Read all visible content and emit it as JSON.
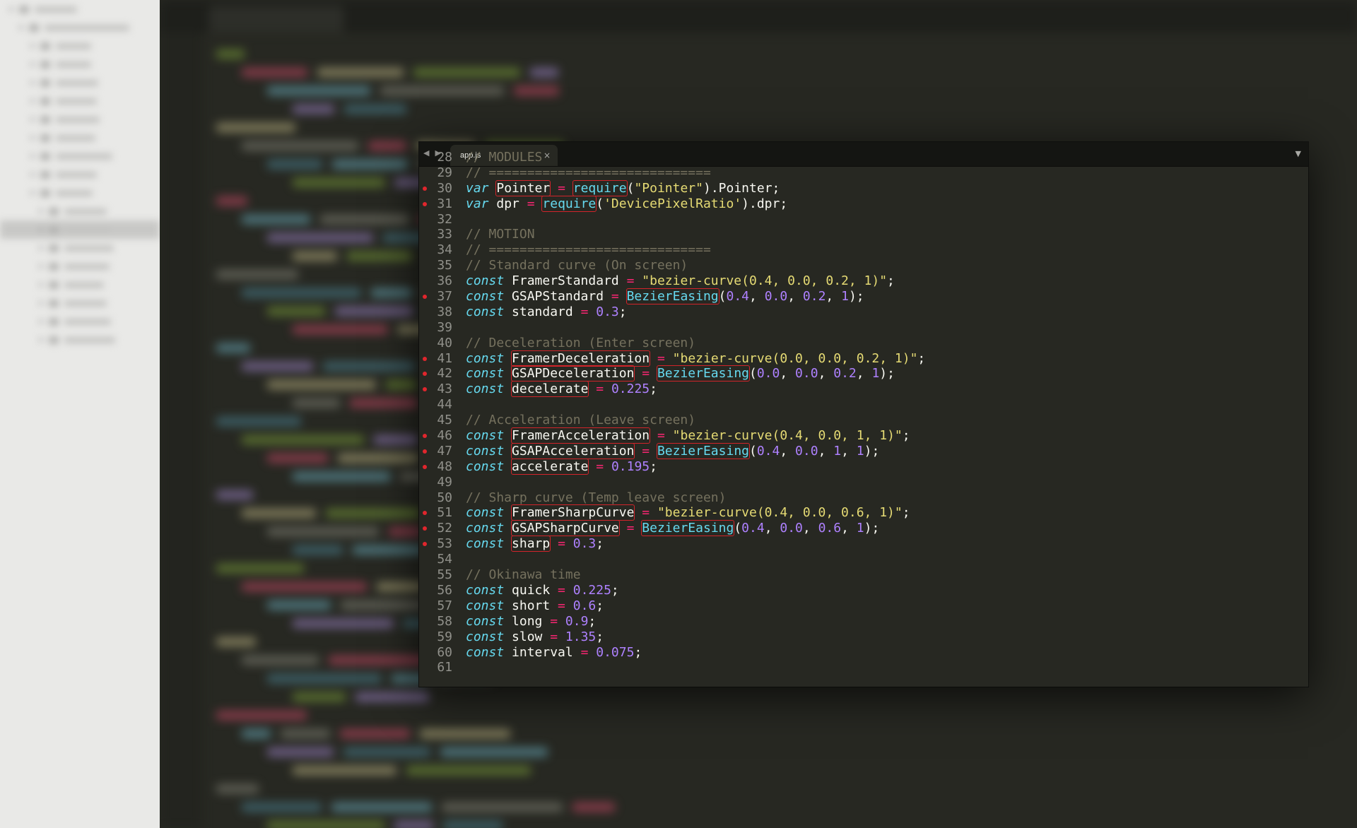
{
  "window": {
    "tab_title": "app.js",
    "nav_back": "◀",
    "nav_forward": "▶",
    "close_glyph": "×",
    "dropdown_glyph": "▼"
  },
  "colors": {
    "background": "#272822",
    "keyword": "#66d9ef",
    "operator": "#f92672",
    "string": "#e6db74",
    "number": "#ae81ff",
    "comment": "#75715e",
    "lint_marker": "#e0262d"
  },
  "code": {
    "lines": [
      {
        "n": "28",
        "marker": false,
        "tokens": [
          {
            "t": "// MODULES",
            "c": "cm"
          }
        ]
      },
      {
        "n": "29",
        "marker": false,
        "tokens": [
          {
            "t": "// =============================",
            "c": "cm"
          }
        ]
      },
      {
        "n": "30",
        "marker": true,
        "tokens": [
          {
            "t": "var",
            "c": "kw"
          },
          {
            "t": " "
          },
          {
            "t": "Pointer",
            "l": true
          },
          {
            "t": " "
          },
          {
            "t": "=",
            "c": "op"
          },
          {
            "t": " "
          },
          {
            "t": "require",
            "c": "fn",
            "l": true
          },
          {
            "t": "("
          },
          {
            "t": "\"Pointer\"",
            "c": "str"
          },
          {
            "t": ").Pointer;"
          }
        ]
      },
      {
        "n": "31",
        "marker": true,
        "tokens": [
          {
            "t": "var",
            "c": "kw"
          },
          {
            "t": " dpr "
          },
          {
            "t": "=",
            "c": "op"
          },
          {
            "t": " "
          },
          {
            "t": "require",
            "c": "fn",
            "l": true
          },
          {
            "t": "("
          },
          {
            "t": "'DevicePixelRatio'",
            "c": "str"
          },
          {
            "t": ").dpr;"
          }
        ]
      },
      {
        "n": "32",
        "marker": false,
        "tokens": []
      },
      {
        "n": "33",
        "marker": false,
        "tokens": [
          {
            "t": "// MOTION",
            "c": "cm"
          }
        ]
      },
      {
        "n": "34",
        "marker": false,
        "tokens": [
          {
            "t": "// =============================",
            "c": "cm"
          }
        ]
      },
      {
        "n": "35",
        "marker": false,
        "tokens": [
          {
            "t": "// Standard curve (On screen)",
            "c": "cm"
          }
        ]
      },
      {
        "n": "36",
        "marker": false,
        "tokens": [
          {
            "t": "const",
            "c": "kw"
          },
          {
            "t": " FramerStandard "
          },
          {
            "t": "=",
            "c": "op"
          },
          {
            "t": " "
          },
          {
            "t": "\"bezier-curve(0.4, 0.0, 0.2, 1)\"",
            "c": "str"
          },
          {
            "t": ";"
          }
        ]
      },
      {
        "n": "37",
        "marker": true,
        "tokens": [
          {
            "t": "const",
            "c": "kw"
          },
          {
            "t": " GSAPStandard "
          },
          {
            "t": "=",
            "c": "op"
          },
          {
            "t": " "
          },
          {
            "t": "BezierEasing",
            "c": "fn",
            "l": true
          },
          {
            "t": "("
          },
          {
            "t": "0.4",
            "c": "num-c"
          },
          {
            "t": ", "
          },
          {
            "t": "0.0",
            "c": "num-c"
          },
          {
            "t": ", "
          },
          {
            "t": "0.2",
            "c": "num-c"
          },
          {
            "t": ", "
          },
          {
            "t": "1",
            "c": "num-c"
          },
          {
            "t": ");"
          }
        ]
      },
      {
        "n": "38",
        "marker": false,
        "tokens": [
          {
            "t": "const",
            "c": "kw"
          },
          {
            "t": " standard "
          },
          {
            "t": "=",
            "c": "op"
          },
          {
            "t": " "
          },
          {
            "t": "0.3",
            "c": "num-c"
          },
          {
            "t": ";"
          }
        ]
      },
      {
        "n": "39",
        "marker": false,
        "tokens": []
      },
      {
        "n": "40",
        "marker": false,
        "tokens": [
          {
            "t": "// Deceleration (Enter screen)",
            "c": "cm"
          }
        ]
      },
      {
        "n": "41",
        "marker": true,
        "tokens": [
          {
            "t": "const",
            "c": "kw"
          },
          {
            "t": " "
          },
          {
            "t": "FramerDeceleration",
            "l": true
          },
          {
            "t": " "
          },
          {
            "t": "=",
            "c": "op"
          },
          {
            "t": " "
          },
          {
            "t": "\"bezier-curve(0.0, 0.0, 0.2, 1)\"",
            "c": "str"
          },
          {
            "t": ";"
          }
        ]
      },
      {
        "n": "42",
        "marker": true,
        "tokens": [
          {
            "t": "const",
            "c": "kw"
          },
          {
            "t": " "
          },
          {
            "t": "GSAPDeceleration",
            "l": true
          },
          {
            "t": " "
          },
          {
            "t": "=",
            "c": "op"
          },
          {
            "t": " "
          },
          {
            "t": "BezierEasing",
            "c": "fn",
            "l": true
          },
          {
            "t": "("
          },
          {
            "t": "0.0",
            "c": "num-c"
          },
          {
            "t": ", "
          },
          {
            "t": "0.0",
            "c": "num-c"
          },
          {
            "t": ", "
          },
          {
            "t": "0.2",
            "c": "num-c"
          },
          {
            "t": ", "
          },
          {
            "t": "1",
            "c": "num-c"
          },
          {
            "t": ");"
          }
        ]
      },
      {
        "n": "43",
        "marker": true,
        "tokens": [
          {
            "t": "const",
            "c": "kw"
          },
          {
            "t": " "
          },
          {
            "t": "decelerate",
            "l": true
          },
          {
            "t": " "
          },
          {
            "t": "=",
            "c": "op"
          },
          {
            "t": " "
          },
          {
            "t": "0.225",
            "c": "num-c"
          },
          {
            "t": ";"
          }
        ]
      },
      {
        "n": "44",
        "marker": false,
        "tokens": []
      },
      {
        "n": "45",
        "marker": false,
        "tokens": [
          {
            "t": "// Acceleration (Leave screen)",
            "c": "cm"
          }
        ]
      },
      {
        "n": "46",
        "marker": true,
        "tokens": [
          {
            "t": "const",
            "c": "kw"
          },
          {
            "t": " "
          },
          {
            "t": "FramerAcceleration",
            "l": true
          },
          {
            "t": " "
          },
          {
            "t": "=",
            "c": "op"
          },
          {
            "t": " "
          },
          {
            "t": "\"bezier-curve(0.4, 0.0, 1, 1)\"",
            "c": "str"
          },
          {
            "t": ";"
          }
        ]
      },
      {
        "n": "47",
        "marker": true,
        "tokens": [
          {
            "t": "const",
            "c": "kw"
          },
          {
            "t": " "
          },
          {
            "t": "GSAPAcceleration",
            "l": true
          },
          {
            "t": " "
          },
          {
            "t": "=",
            "c": "op"
          },
          {
            "t": " "
          },
          {
            "t": "BezierEasing",
            "c": "fn",
            "l": true
          },
          {
            "t": "("
          },
          {
            "t": "0.4",
            "c": "num-c"
          },
          {
            "t": ", "
          },
          {
            "t": "0.0",
            "c": "num-c"
          },
          {
            "t": ", "
          },
          {
            "t": "1",
            "c": "num-c"
          },
          {
            "t": ", "
          },
          {
            "t": "1",
            "c": "num-c"
          },
          {
            "t": ");"
          }
        ]
      },
      {
        "n": "48",
        "marker": true,
        "tokens": [
          {
            "t": "const",
            "c": "kw"
          },
          {
            "t": " "
          },
          {
            "t": "accelerate",
            "l": true
          },
          {
            "t": " "
          },
          {
            "t": "=",
            "c": "op"
          },
          {
            "t": " "
          },
          {
            "t": "0.195",
            "c": "num-c"
          },
          {
            "t": ";"
          }
        ]
      },
      {
        "n": "49",
        "marker": false,
        "tokens": []
      },
      {
        "n": "50",
        "marker": false,
        "tokens": [
          {
            "t": "// Sharp curve (Temp leave screen)",
            "c": "cm"
          }
        ]
      },
      {
        "n": "51",
        "marker": true,
        "tokens": [
          {
            "t": "const",
            "c": "kw"
          },
          {
            "t": " "
          },
          {
            "t": "FramerSharpCurve",
            "l": true
          },
          {
            "t": " "
          },
          {
            "t": "=",
            "c": "op"
          },
          {
            "t": " "
          },
          {
            "t": "\"bezier-curve(0.4, 0.0, 0.6, 1)\"",
            "c": "str"
          },
          {
            "t": ";"
          }
        ]
      },
      {
        "n": "52",
        "marker": true,
        "tokens": [
          {
            "t": "const",
            "c": "kw"
          },
          {
            "t": " "
          },
          {
            "t": "GSAPSharpCurve",
            "l": true
          },
          {
            "t": " "
          },
          {
            "t": "=",
            "c": "op"
          },
          {
            "t": " "
          },
          {
            "t": "BezierEasing",
            "c": "fn",
            "l": true
          },
          {
            "t": "("
          },
          {
            "t": "0.4",
            "c": "num-c"
          },
          {
            "t": ", "
          },
          {
            "t": "0.0",
            "c": "num-c"
          },
          {
            "t": ", "
          },
          {
            "t": "0.6",
            "c": "num-c"
          },
          {
            "t": ", "
          },
          {
            "t": "1",
            "c": "num-c"
          },
          {
            "t": ");"
          }
        ]
      },
      {
        "n": "53",
        "marker": true,
        "tokens": [
          {
            "t": "const",
            "c": "kw"
          },
          {
            "t": " "
          },
          {
            "t": "sharp",
            "l": true
          },
          {
            "t": " "
          },
          {
            "t": "=",
            "c": "op"
          },
          {
            "t": " "
          },
          {
            "t": "0.3",
            "c": "num-c"
          },
          {
            "t": ";"
          }
        ]
      },
      {
        "n": "54",
        "marker": false,
        "tokens": []
      },
      {
        "n": "55",
        "marker": false,
        "tokens": [
          {
            "t": "// Okinawa time",
            "c": "cm"
          }
        ]
      },
      {
        "n": "56",
        "marker": false,
        "tokens": [
          {
            "t": "const",
            "c": "kw"
          },
          {
            "t": " quick "
          },
          {
            "t": "=",
            "c": "op"
          },
          {
            "t": " "
          },
          {
            "t": "0.225",
            "c": "num-c"
          },
          {
            "t": ";"
          }
        ]
      },
      {
        "n": "57",
        "marker": false,
        "tokens": [
          {
            "t": "const",
            "c": "kw"
          },
          {
            "t": " short "
          },
          {
            "t": "=",
            "c": "op"
          },
          {
            "t": " "
          },
          {
            "t": "0.6",
            "c": "num-c"
          },
          {
            "t": ";"
          }
        ]
      },
      {
        "n": "58",
        "marker": false,
        "tokens": [
          {
            "t": "const",
            "c": "kw"
          },
          {
            "t": " long "
          },
          {
            "t": "=",
            "c": "op"
          },
          {
            "t": " "
          },
          {
            "t": "0.9",
            "c": "num-c"
          },
          {
            "t": ";"
          }
        ]
      },
      {
        "n": "59",
        "marker": false,
        "tokens": [
          {
            "t": "const",
            "c": "kw"
          },
          {
            "t": " slow "
          },
          {
            "t": "=",
            "c": "op"
          },
          {
            "t": " "
          },
          {
            "t": "1.35",
            "c": "num-c"
          },
          {
            "t": ";"
          }
        ]
      },
      {
        "n": "60",
        "marker": false,
        "tokens": [
          {
            "t": "const",
            "c": "kw"
          },
          {
            "t": " interval "
          },
          {
            "t": "=",
            "c": "op"
          },
          {
            "t": " "
          },
          {
            "t": "0.075",
            "c": "num-c"
          },
          {
            "t": ";"
          }
        ]
      },
      {
        "n": "61",
        "marker": false,
        "tokens": []
      }
    ]
  }
}
